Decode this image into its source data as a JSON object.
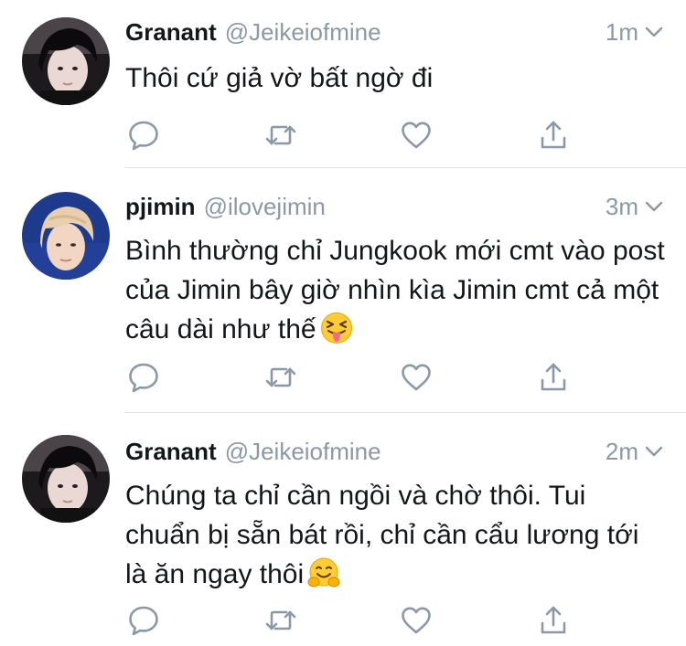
{
  "tweets": [
    {
      "name": "Granant",
      "handle": "@Jeikeiofmine",
      "time": "1m",
      "text": "Thôi cứ giả vờ bất ngờ đi",
      "emoji": "",
      "avatar_icon": "avatar-dark-hair-person"
    },
    {
      "name": "pjimin",
      "handle": "@ilovejimin",
      "time": "3m",
      "text": "Bình thường chỉ Jungkook mới cmt vào post của Jimin bây giờ nhìn kìa Jimin cmt cả một câu dài như thế",
      "emoji": "squinting-tongue-emoji",
      "avatar_icon": "avatar-blonde-person-blue-background"
    },
    {
      "name": "Granant",
      "handle": "@Jeikeiofmine",
      "time": "2m",
      "text": "Chúng ta chỉ cần ngồi và chờ thôi. Tui chuẩn bị sẵn bát rồi, chỉ cần cẩu lương tới là ăn ngay thôi",
      "emoji": "hugging-face-emoji",
      "avatar_icon": "avatar-dark-hair-person"
    }
  ],
  "colors": {
    "text": "#14171a",
    "secondary": "#8b98a5",
    "icon": "#8b98a5",
    "divider": "#dfe3e6"
  }
}
